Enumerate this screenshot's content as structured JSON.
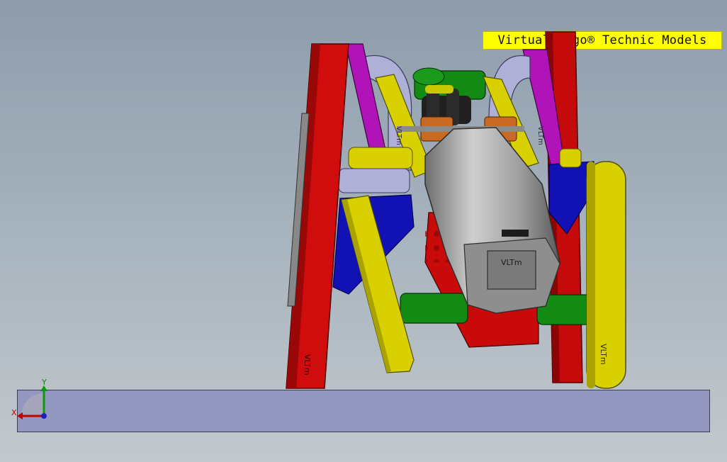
{
  "window": {
    "banner_text": "Virtual Lego® Technic Models"
  },
  "model": {
    "beam_labels": [
      "VLTm",
      "VLTm",
      "VLTm",
      "VLTm",
      "VLTm"
    ],
    "motor_label": "VLTm"
  },
  "triad": {
    "y_label": "Y",
    "x_label": "X"
  },
  "colors": {
    "background_top": "#8e9cab",
    "background_bottom": "#c3c8cc",
    "banner": "#ffff00",
    "floor": "#9497bf",
    "red_beam": "#d00c0c",
    "yellow_beam": "#d8d000",
    "magenta_beam": "#b014b8",
    "lavender_beam": "#aeb0d8",
    "blue_beam": "#1010b8",
    "green_axle": "#108010",
    "motor_gray": "#9a9a9a",
    "orange_connector": "#c86a22"
  },
  "icons": [
    "coordinate-triad-icon"
  ]
}
